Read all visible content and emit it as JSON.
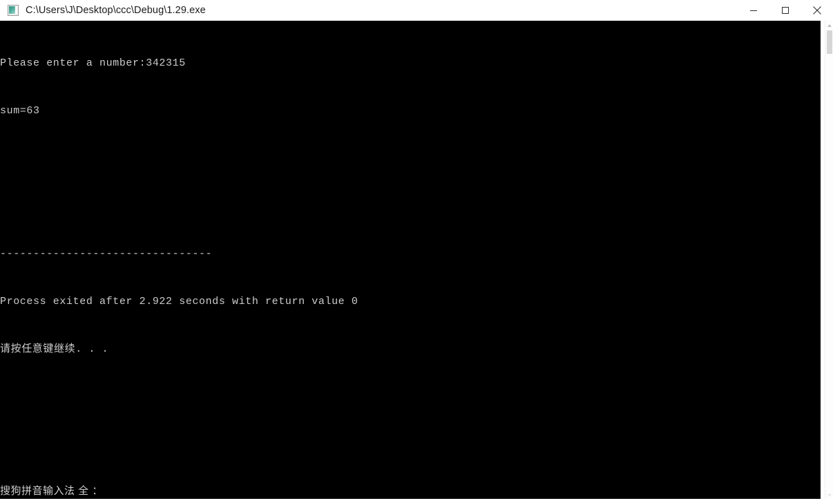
{
  "window": {
    "title": "C:\\Users\\J\\Desktop\\ccc\\Debug\\1.29.exe",
    "icon_name": "console-app-icon",
    "controls": {
      "minimize_label": "Minimize",
      "maximize_label": "Maximize",
      "close_label": "Close"
    },
    "background_color": "#000000",
    "titlebar_color": "#ffffff",
    "text_color": "#cccccc"
  },
  "console": {
    "lines": [
      "Please enter a number:342315",
      "sum=63",
      "",
      "",
      "--------------------------------",
      "Process exited after 2.922 seconds with return value 0",
      "请按任意键继续. . ."
    ],
    "prompt": "Please enter a number:",
    "input_value": "342315",
    "result_label": "sum=",
    "result_value": "63",
    "separator": "--------------------------------",
    "exit_message": "Process exited after 2.922 seconds with return value 0",
    "exit_seconds": "2.922",
    "return_value": "0",
    "press_any_key": "请按任意键继续. . ."
  },
  "ime": {
    "status_text": "搜狗拼音输入法 全 ："
  },
  "scrollbar": {
    "position_percent": 2,
    "thumb_size_percent": 5
  }
}
